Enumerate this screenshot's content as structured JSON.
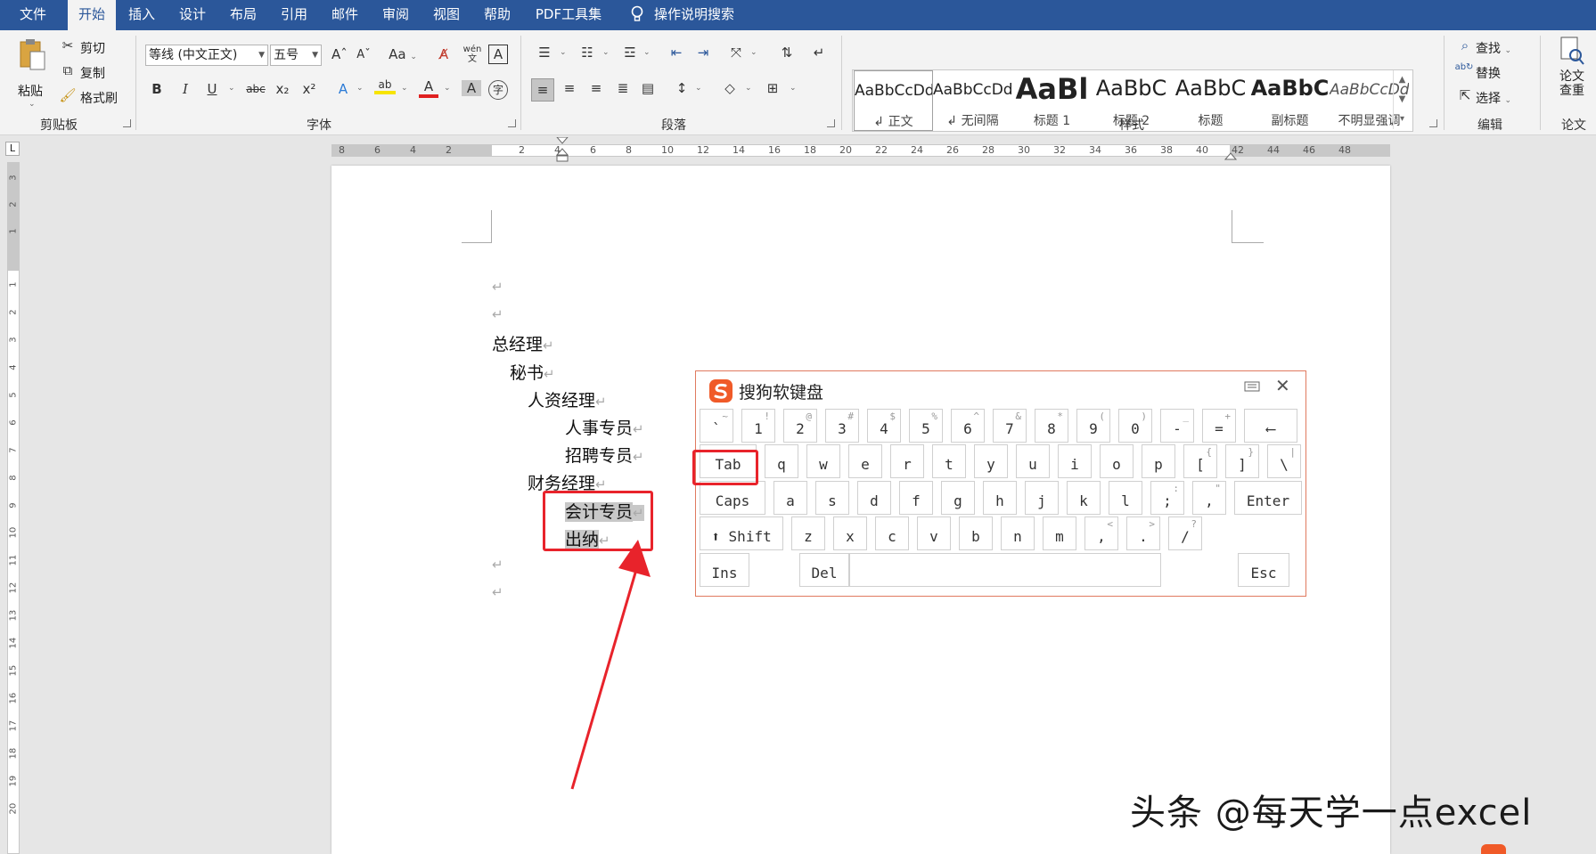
{
  "menubar": {
    "items": [
      "文件",
      "开始",
      "插入",
      "设计",
      "布局",
      "引用",
      "邮件",
      "审阅",
      "视图",
      "帮助",
      "PDF工具集"
    ],
    "active_index": 1,
    "search": "操作说明搜索"
  },
  "ribbon": {
    "clipboard": {
      "paste": "粘贴",
      "cut": "剪切",
      "copy": "复制",
      "format_painter": "格式刷",
      "label": "剪贴板"
    },
    "font": {
      "name": "等线 (中文正文)",
      "size": "五号",
      "label": "字体",
      "bold": "B",
      "italic": "I",
      "underline": "U",
      "strike": "abc",
      "sub": "x₂",
      "sup": "x²",
      "grow": "A",
      "shrink": "A",
      "case": "Aa",
      "pinyin": "wén"
    },
    "paragraph": {
      "label": "段落"
    },
    "styles": {
      "label": "样式",
      "items": [
        {
          "sample": "AaBbCcDd",
          "name": "↲ 正文",
          "size": 17
        },
        {
          "sample": "AaBbCcDd",
          "name": "↲ 无间隔",
          "size": 17
        },
        {
          "sample": "AaBl",
          "name": "标题 1",
          "size": 32
        },
        {
          "sample": "AaBbC",
          "name": "标题 2",
          "size": 24
        },
        {
          "sample": "AaBbC",
          "name": "标题",
          "size": 24
        },
        {
          "sample": "AaBbC",
          "name": "副标题",
          "size": 24
        },
        {
          "sample": "AaBbCcDd",
          "name": "不明显强调",
          "size": 17
        }
      ]
    },
    "editing": {
      "find": "查找",
      "replace": "替换",
      "select": "选择",
      "label": "编辑"
    },
    "thesis": {
      "check_line1": "论文",
      "check_line2": "查重",
      "label": "论文"
    }
  },
  "hruler": {
    "ticks": [
      "8",
      "6",
      "4",
      "2",
      "2",
      "4",
      "6",
      "8",
      "10",
      "12",
      "14",
      "16",
      "18",
      "20",
      "22",
      "24",
      "26",
      "28",
      "30",
      "32",
      "34",
      "36",
      "38",
      "40",
      "42",
      "44",
      "46",
      "48"
    ]
  },
  "vruler": {
    "ticks": [
      "3",
      "2",
      "1",
      "1",
      "2",
      "3",
      "4",
      "5",
      "6",
      "7",
      "8",
      "9",
      "10",
      "11",
      "12",
      "13",
      "14",
      "15",
      "16",
      "17",
      "18",
      "19",
      "20"
    ]
  },
  "document": {
    "paragraph_mark": "↵",
    "lines": [
      {
        "text": "",
        "indent": 0
      },
      {
        "text": "",
        "indent": 0
      },
      {
        "text": "总经理",
        "indent": 0
      },
      {
        "text": "秘书",
        "indent": 1
      },
      {
        "text": "人资经理",
        "indent": 2
      },
      {
        "text": "人事专员",
        "indent": 4
      },
      {
        "text": "招聘专员",
        "indent": 4
      },
      {
        "text": "财务经理",
        "indent": 2
      },
      {
        "text": "会计专员",
        "indent": 4,
        "selected": true
      },
      {
        "text": "出纳",
        "indent": 4,
        "selected": true
      },
      {
        "text": "",
        "indent": 0
      },
      {
        "text": "",
        "indent": 0
      }
    ]
  },
  "keyboard": {
    "title": "搜狗软键盘",
    "rows": [
      [
        [
          "`",
          "~"
        ],
        [
          "1",
          "!"
        ],
        [
          "2",
          "@"
        ],
        [
          "3",
          "#"
        ],
        [
          "4",
          "$"
        ],
        [
          "5",
          "%"
        ],
        [
          "6",
          "^"
        ],
        [
          "7",
          "&"
        ],
        [
          "8",
          "*"
        ],
        [
          "9",
          "("
        ],
        [
          "0",
          ")"
        ],
        [
          "-",
          "_"
        ],
        [
          "=",
          "+"
        ],
        [
          "⟵",
          ""
        ]
      ],
      [
        [
          "Tab",
          ""
        ],
        [
          "q",
          ""
        ],
        [
          "w",
          ""
        ],
        [
          "e",
          ""
        ],
        [
          "r",
          ""
        ],
        [
          "t",
          ""
        ],
        [
          "y",
          ""
        ],
        [
          "u",
          ""
        ],
        [
          "i",
          ""
        ],
        [
          "o",
          ""
        ],
        [
          "p",
          ""
        ],
        [
          "[",
          "{"
        ],
        [
          "]",
          "}"
        ],
        [
          "\\",
          "|"
        ]
      ],
      [
        [
          "Caps",
          ""
        ],
        [
          "a",
          ""
        ],
        [
          "s",
          ""
        ],
        [
          "d",
          ""
        ],
        [
          "f",
          ""
        ],
        [
          "g",
          ""
        ],
        [
          "h",
          ""
        ],
        [
          "j",
          ""
        ],
        [
          "k",
          ""
        ],
        [
          "l",
          ""
        ],
        [
          ";",
          ":"
        ],
        [
          ",",
          "\""
        ],
        [
          "Enter",
          ""
        ]
      ],
      [
        [
          "⬆ Shift",
          ""
        ],
        [
          "z",
          ""
        ],
        [
          "x",
          ""
        ],
        [
          "c",
          ""
        ],
        [
          "v",
          ""
        ],
        [
          "b",
          ""
        ],
        [
          "n",
          ""
        ],
        [
          "m",
          ""
        ],
        [
          ",",
          "<"
        ],
        [
          ".",
          ">"
        ],
        [
          "/",
          "?"
        ]
      ],
      [
        [
          "Ins",
          ""
        ],
        [
          "Del",
          ""
        ],
        [
          "",
          ""
        ],
        [
          "Esc",
          ""
        ]
      ]
    ],
    "highlighted_key": "Tab"
  },
  "watermark": "头条 @每天学一点excel",
  "colors": {
    "accent": "#2b579a",
    "highlight": "#e8232b",
    "sogou": "#f05a28"
  }
}
